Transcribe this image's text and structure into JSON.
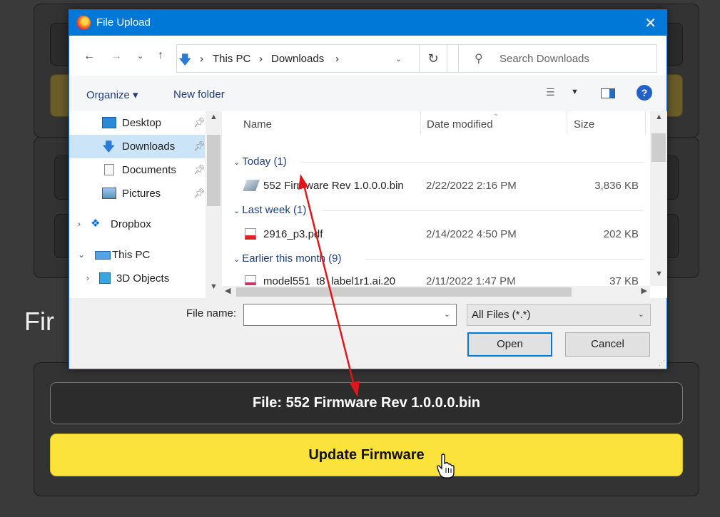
{
  "background": {
    "section_title_partial": "Fir",
    "file_label": "File: 552 Firmware Rev 1.0.0.0.bin",
    "update_button": "Update Firmware"
  },
  "dialog": {
    "title": "File Upload",
    "address": {
      "crumbs": [
        "This PC",
        "Downloads"
      ],
      "search_placeholder": "Search Downloads"
    },
    "toolbar": {
      "organize": "Organize ▾",
      "new_folder": "New folder"
    },
    "nav": [
      {
        "label": "Desktop",
        "icon": "desktop-icon",
        "pinned": true
      },
      {
        "label": "Downloads",
        "icon": "download-folder-icon",
        "pinned": true,
        "selected": true
      },
      {
        "label": "Documents",
        "icon": "documents-icon",
        "pinned": true
      },
      {
        "label": "Pictures",
        "icon": "pictures-icon",
        "pinned": true
      },
      {
        "label": "Dropbox",
        "icon": "dropbox-icon"
      },
      {
        "label": "This PC",
        "icon": "this-pc-icon"
      },
      {
        "label": "3D Objects",
        "icon": "3d-objects-icon"
      }
    ],
    "columns": {
      "name": "Name",
      "date": "Date modified",
      "size": "Size"
    },
    "groups": {
      "today": "Today (1)",
      "last_week": "Last week (1)",
      "earlier": "Earlier this month (9)"
    },
    "files": [
      {
        "name": "552 Firmware Rev 1.0.0.0.bin",
        "date": "2/22/2022 2:16 PM",
        "size": "3,836 KB"
      },
      {
        "name": "2916_p3.pdf",
        "date": "2/14/2022 4:50 PM",
        "size": "202 KB"
      },
      {
        "name": "model551_t8_label1r1.ai.20",
        "date": "2/11/2022 1:47 PM",
        "size": "37 KB"
      }
    ],
    "file_name_label": "File name:",
    "file_name_value": "",
    "filter": "All Files (*.*)",
    "open_button": "Open",
    "cancel_button": "Cancel"
  },
  "colors": {
    "titlebar": "#0078d7",
    "update_button": "#fce33b",
    "annotation_arrow": "#e0161b"
  }
}
